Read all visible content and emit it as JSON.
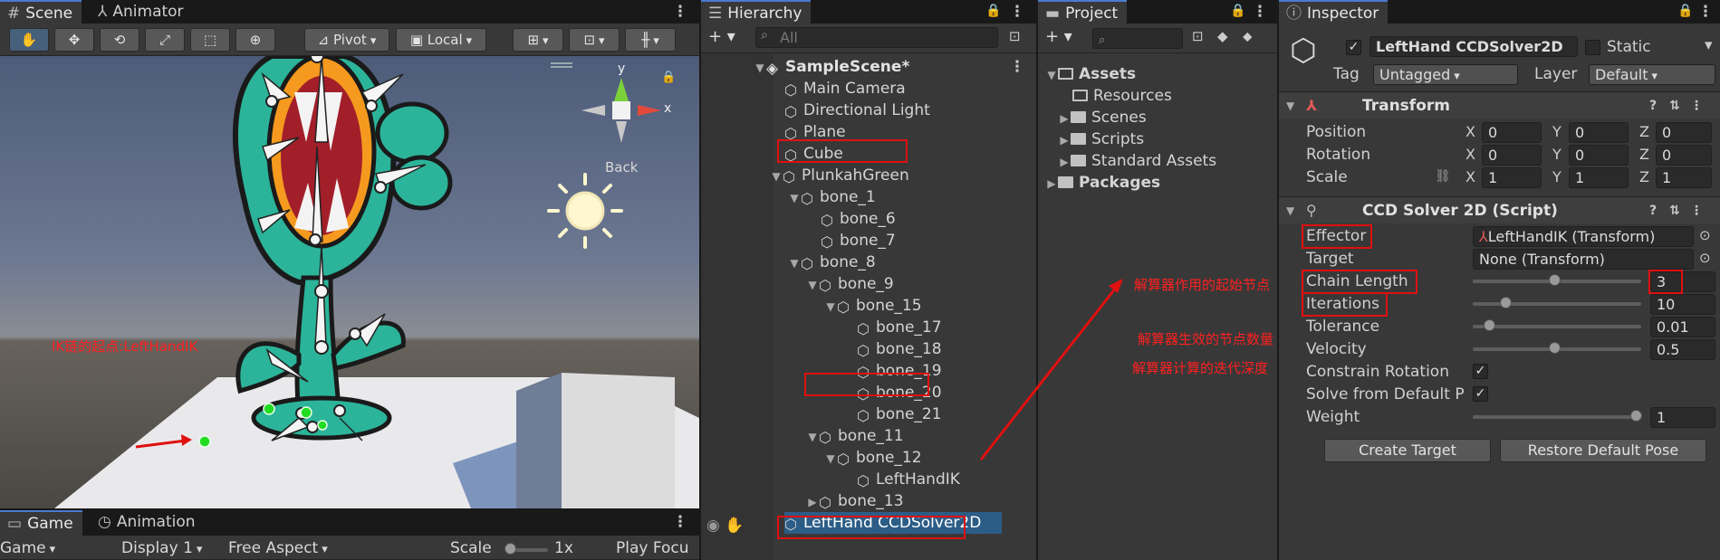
{
  "scene_panel": {
    "tabs": [
      {
        "label": "Scene",
        "icon": "hash-icon",
        "active": true
      },
      {
        "label": "Animator",
        "icon": "animator-icon",
        "active": false
      }
    ],
    "toolbar": {
      "pivot": "Pivot",
      "local": "Local"
    },
    "gizmo": {
      "y_label": "y",
      "x_label": "x",
      "back_label": "Back"
    },
    "annotation_ik_start": "IK链的起点:LeftHandIK"
  },
  "game_panel": {
    "tabs": [
      {
        "label": "Game",
        "icon": "game-icon",
        "active": true
      },
      {
        "label": "Animation",
        "icon": "animation-icon",
        "active": false
      }
    ],
    "toolbar": {
      "game": "Game",
      "display": "Display 1",
      "aspect": "Free Aspect",
      "scale_label": "Scale",
      "scale_value": "1x",
      "play_focus": "Play Focu"
    }
  },
  "hierarchy": {
    "title": "Hierarchy",
    "search_placeholder": "All",
    "scene_name": "SampleScene*",
    "items": [
      {
        "label": "Main Camera"
      },
      {
        "label": "Directional Light"
      },
      {
        "label": "Plane"
      },
      {
        "label": "Cube"
      },
      {
        "label": "PlunkahGreen"
      },
      {
        "label": "bone_1"
      },
      {
        "label": "bone_6"
      },
      {
        "label": "bone_7"
      },
      {
        "label": "bone_8"
      },
      {
        "label": "bone_9"
      },
      {
        "label": "bone_15"
      },
      {
        "label": "bone_17"
      },
      {
        "label": "bone_18"
      },
      {
        "label": "bone_19"
      },
      {
        "label": "bone_20"
      },
      {
        "label": "bone_21"
      },
      {
        "label": "bone_11"
      },
      {
        "label": "bone_12"
      },
      {
        "label": "LeftHandIK"
      },
      {
        "label": "bone_13"
      },
      {
        "label": "LeftHand CCDSolver2D"
      }
    ]
  },
  "project": {
    "title": "Project",
    "tree": [
      {
        "label": "Assets"
      },
      {
        "label": "Resources"
      },
      {
        "label": "Scenes"
      },
      {
        "label": "Scripts"
      },
      {
        "label": "Standard Assets"
      },
      {
        "label": "Packages"
      }
    ]
  },
  "inspector": {
    "title": "Inspector",
    "object_name": "LeftHand CCDSolver2D",
    "static_label": "Static",
    "tag_label": "Tag",
    "tag_value": "Untagged",
    "layer_label": "Layer",
    "layer_value": "Default",
    "transform": {
      "title": "Transform",
      "position_label": "Position",
      "rotation_label": "Rotation",
      "scale_label": "Scale",
      "x": "X",
      "y": "Y",
      "z": "Z",
      "position": [
        "0",
        "0",
        "0"
      ],
      "rotation": [
        "0",
        "0",
        "0"
      ],
      "scale": [
        "1",
        "1",
        "1"
      ]
    },
    "ccd": {
      "title": "CCD Solver 2D (Script)",
      "effector_label": "Effector",
      "effector_value": "LeftHandIK (Transform)",
      "target_label": "Target",
      "target_value": "None (Transform)",
      "chain_label": "Chain Length",
      "chain_value": "3",
      "chain_slider": 0.5,
      "iterations_label": "Iterations",
      "iterations_value": "10",
      "iterations_slider": 0.2,
      "tolerance_label": "Tolerance",
      "tolerance_value": "0.01",
      "tolerance_slider": 0.1,
      "velocity_label": "Velocity",
      "velocity_value": "0.5",
      "velocity_slider": 0.5,
      "constrain_label": "Constrain Rotation",
      "solve_default_label": "Solve from Default P",
      "weight_label": "Weight",
      "weight_value": "1",
      "weight_slider": 1.0,
      "create_target": "Create Target",
      "restore_pose": "Restore Default Pose"
    },
    "annotations": {
      "effector": "解算器作用的起始节点",
      "chain": "解算器生效的节点数量",
      "iterations": "解算器计算的迭代深度"
    }
  },
  "colors": {
    "panel_bg": "#383838",
    "dark_bg": "#191919",
    "selection": "#2c5d87",
    "annotation_red": "#e01010",
    "ik_green": "#22dd22"
  }
}
